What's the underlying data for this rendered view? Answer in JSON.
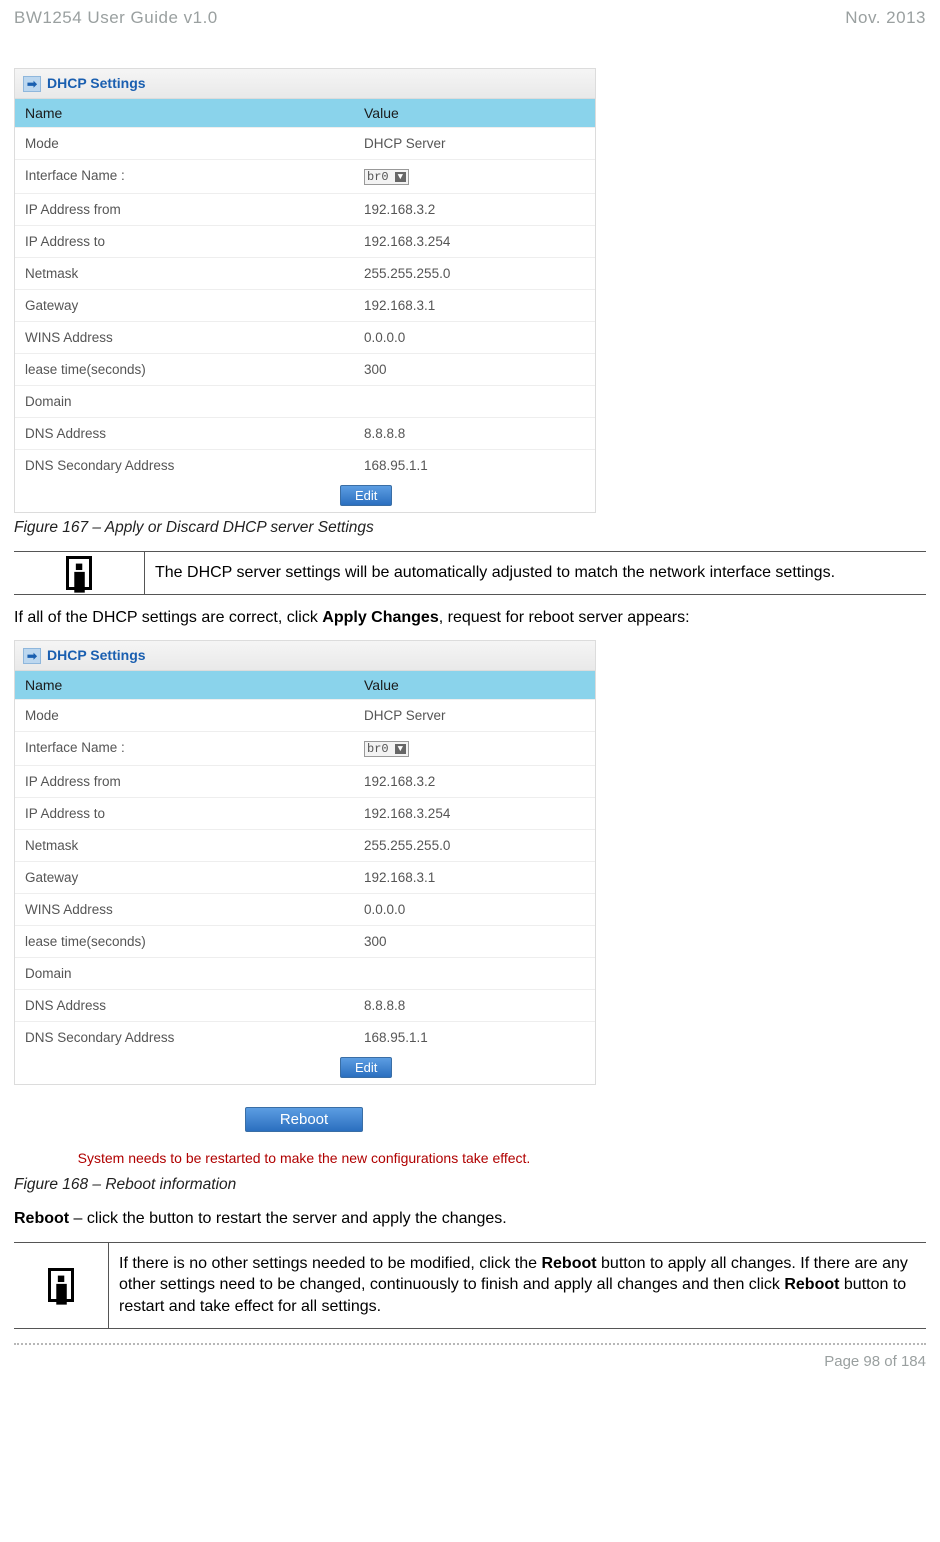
{
  "header": {
    "left": "BW1254 User Guide v1.0",
    "right": "Nov.  2013"
  },
  "panel": {
    "title": "DHCP Settings",
    "columns": {
      "name": "Name",
      "value": "Value"
    },
    "rows": [
      {
        "name": "Mode",
        "value": "DHCP Server",
        "control": "text"
      },
      {
        "name": "Interface Name :",
        "value": "br0",
        "control": "select"
      },
      {
        "name": "IP Address from",
        "value": "192.168.3.2",
        "control": "text"
      },
      {
        "name": "IP Address to",
        "value": "192.168.3.254",
        "control": "text"
      },
      {
        "name": "Netmask",
        "value": "255.255.255.0",
        "control": "text"
      },
      {
        "name": "Gateway",
        "value": "192.168.3.1",
        "control": "text"
      },
      {
        "name": "WINS Address",
        "value": "0.0.0.0",
        "control": "text"
      },
      {
        "name": "lease time(seconds)",
        "value": "300",
        "control": "text"
      },
      {
        "name": "Domain",
        "value": "",
        "control": "text"
      },
      {
        "name": "DNS Address",
        "value": "8.8.8.8",
        "control": "text"
      },
      {
        "name": "DNS Secondary Address",
        "value": "168.95.1.1",
        "control": "text"
      }
    ],
    "edit_label": "Edit"
  },
  "caption1": "Figure 167 – Apply or Discard DHCP server Settings",
  "note1": "The DHCP server settings will be automatically adjusted to match the network interface settings.",
  "para1_pre": "If all of the DHCP settings are correct, click ",
  "para1_bold": "Apply Changes",
  "para1_post": ", request for reboot server appears:",
  "reboot_label": "Reboot",
  "restart_msg": "System needs to be restarted to make the new configurations take effect.",
  "caption2": "Figure 168 – Reboot information",
  "reboot_line_bold": "Reboot",
  "reboot_line_rest": " – click the button to restart the server and apply the changes.",
  "note2_p1": "If there is no other settings needed to be modified, click the ",
  "note2_b1": "Reboot",
  "note2_p2": " button to apply all changes. If there are any other settings need to be changed, continuously to finish and apply all changes and then click ",
  "note2_b2": "Reboot",
  "note2_p3": " button to restart and take effect  for all settings.",
  "footer": "Page 98 of 184"
}
